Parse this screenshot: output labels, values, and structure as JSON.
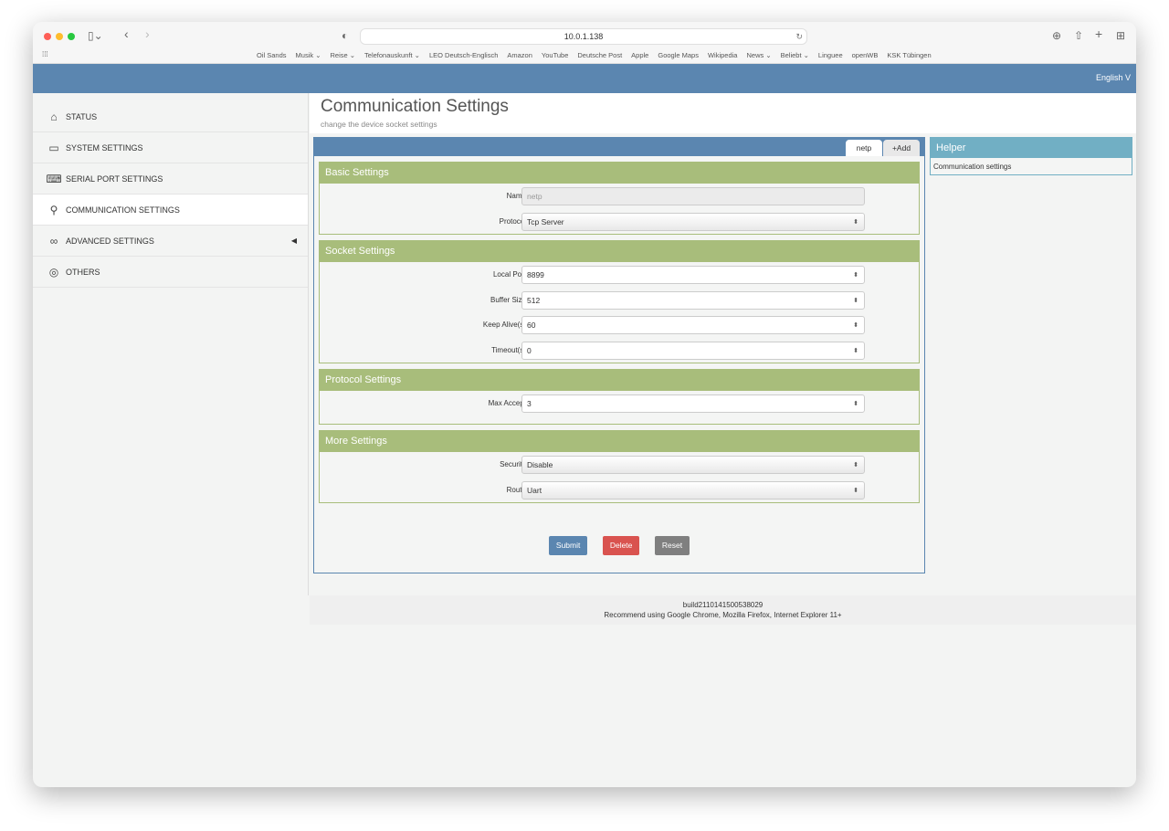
{
  "browser": {
    "url": "10.0.1.138",
    "bookmarks": [
      "Oil Sands",
      "Musik ⌄",
      "Reise ⌄",
      "Telefonauskunft ⌄",
      "LEO Deutsch-Englisch",
      "Amazon",
      "YouTube",
      "Deutsche Post",
      "Apple",
      "Google Maps",
      "Wikipedia",
      "News ⌄",
      "Beliebt ⌄",
      "Linguee",
      "openWB",
      "KSK Tübingen"
    ]
  },
  "header": {
    "language": "English V"
  },
  "sidebar": {
    "items": [
      {
        "label": "STATUS",
        "icon": "⌂"
      },
      {
        "label": "SYSTEM SETTINGS",
        "icon": "▭"
      },
      {
        "label": "SERIAL PORT SETTINGS",
        "icon": "⌨"
      },
      {
        "label": "COMMUNICATION SETTINGS",
        "icon": "⚲"
      },
      {
        "label": "ADVANCED SETTINGS",
        "icon": "∞"
      },
      {
        "label": "OTHERS",
        "icon": "◎"
      }
    ]
  },
  "page": {
    "title": "Communication Settings",
    "subtitle": "change the device socket settings"
  },
  "tabs": {
    "active": "netp",
    "add": "+Add"
  },
  "sections": {
    "basic": {
      "title": "Basic Settings",
      "name_label": "Name",
      "name_value": "netp",
      "protocol_label": "Protocol",
      "protocol_value": "Tcp Server"
    },
    "socket": {
      "title": "Socket Settings",
      "local_port_label": "Local Port",
      "local_port": "8899",
      "buffer_label": "Buffer Size",
      "buffer": "512",
      "keepalive_label": "Keep Alive(s)",
      "keepalive": "60",
      "timeout_label": "Timeout(s)",
      "timeout": "0"
    },
    "protocol": {
      "title": "Protocol Settings",
      "max_accept_label": "Max Accept",
      "max_accept": "3"
    },
    "more": {
      "title": "More Settings",
      "security_label": "Security",
      "security": "Disable",
      "route_label": "Route",
      "route": "Uart"
    }
  },
  "buttons": {
    "submit": "Submit",
    "delete": "Delete",
    "reset": "Reset"
  },
  "helper": {
    "title": "Helper",
    "text": "Communication settings"
  },
  "footer": {
    "build": "build2110141500538029",
    "recommend": "Recommend using Google Chrome, Mozilla Firefox, Internet Explorer 11+"
  },
  "colors": {
    "primary": "#5b86b0",
    "section": "#a8bd7b",
    "helper": "#71afc4",
    "danger": "#d9534f",
    "neutral": "#7f7f7f"
  }
}
